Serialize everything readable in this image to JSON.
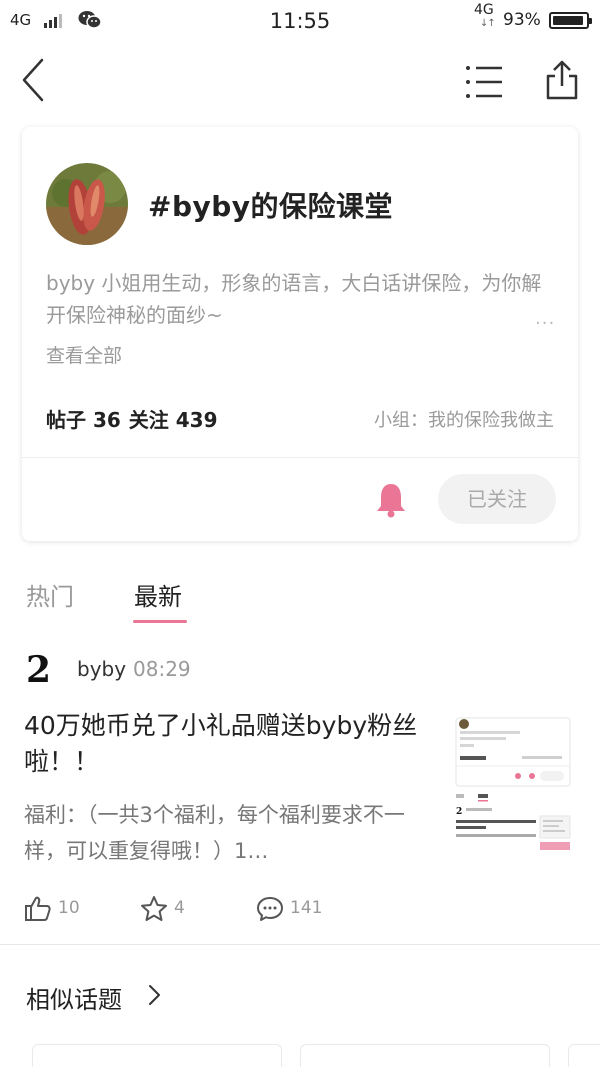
{
  "status_bar": {
    "network": "4G",
    "network2": "4G",
    "arrows": "↓↑",
    "time": "11:55",
    "battery_text": "93%",
    "battery_level": 0.93
  },
  "nav": {
    "back_icon": "back-arrow-icon",
    "menu_icon": "list-menu-icon",
    "share_icon": "share-icon"
  },
  "topic": {
    "title": "#byby的保险课堂",
    "description": "byby 小姐用生动，形象的语言，大白话讲保险，为你解开保险神秘的面纱~",
    "more_dots": "···",
    "view_all": "查看全部",
    "posts": "帖子 36",
    "follows": "关注 439",
    "group": "小组：我的保险我做主",
    "follow_button": "已关注",
    "accent_color": "#ea7595"
  },
  "tabs": [
    {
      "label": "热门",
      "active": false
    },
    {
      "label": "最新",
      "active": true
    }
  ],
  "post": {
    "author_avatar_text": "2",
    "author": "byby",
    "time": "08:29",
    "title": "40万她币兑了小礼品赠送byby粉丝啦！！",
    "excerpt": "福利：（一共3个福利，每个福利要求不一样，可以重复得哦！）1…",
    "likes": "10",
    "favorites": "4",
    "comments": "141"
  },
  "similar": {
    "title": "相似话题"
  }
}
